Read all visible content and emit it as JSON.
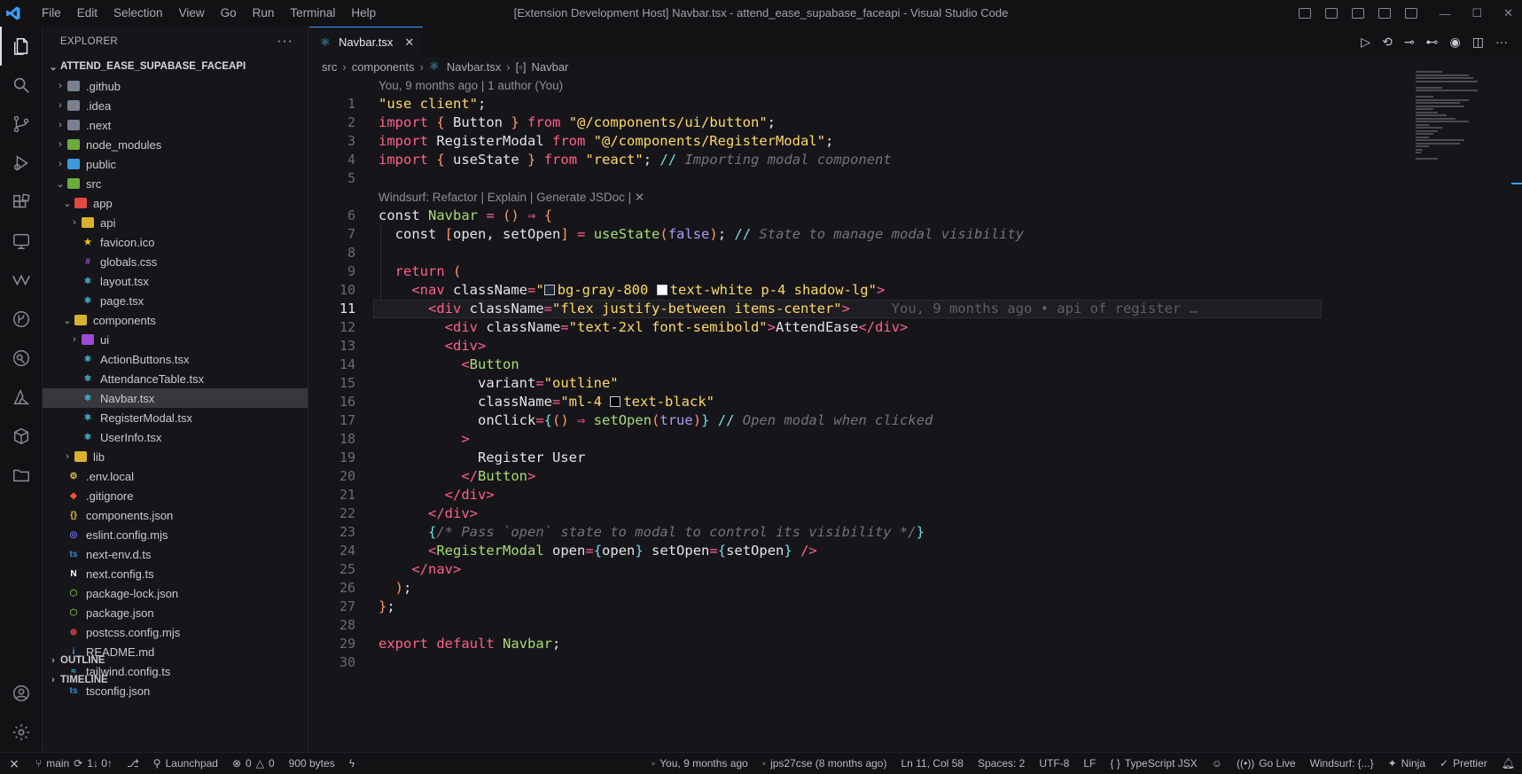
{
  "titlebar": {
    "menu": [
      "File",
      "Edit",
      "Selection",
      "View",
      "Go",
      "Run",
      "Terminal",
      "Help"
    ],
    "title": "[Extension Development Host] Navbar.tsx - attend_ease_supabase_faceapi - Visual Studio Code"
  },
  "sidebar": {
    "header": "EXPLORER",
    "project": "ATTEND_EASE_SUPABASE_FACEAPI",
    "tree": [
      {
        "label": ".github",
        "depth": 1,
        "type": "folder",
        "open": false,
        "color": "gray"
      },
      {
        "label": ".idea",
        "depth": 1,
        "type": "folder",
        "open": false,
        "color": "gray"
      },
      {
        "label": ".next",
        "depth": 1,
        "type": "folder",
        "open": false,
        "color": "gray"
      },
      {
        "label": "node_modules",
        "depth": 1,
        "type": "folder",
        "open": false,
        "color": "green"
      },
      {
        "label": "public",
        "depth": 1,
        "type": "folder",
        "open": false,
        "color": "blue"
      },
      {
        "label": "src",
        "depth": 1,
        "type": "folder",
        "open": true,
        "color": "green"
      },
      {
        "label": "app",
        "depth": 2,
        "type": "folder",
        "open": true,
        "color": "red"
      },
      {
        "label": "api",
        "depth": 3,
        "type": "folder",
        "open": false,
        "color": "yellow"
      },
      {
        "label": "favicon.ico",
        "depth": 3,
        "type": "file",
        "icon": "star"
      },
      {
        "label": "globals.css",
        "depth": 3,
        "type": "file",
        "icon": "css"
      },
      {
        "label": "layout.tsx",
        "depth": 3,
        "type": "file",
        "icon": "react"
      },
      {
        "label": "page.tsx",
        "depth": 3,
        "type": "file",
        "icon": "react"
      },
      {
        "label": "components",
        "depth": 2,
        "type": "folder",
        "open": true,
        "color": "yellow"
      },
      {
        "label": "ui",
        "depth": 3,
        "type": "folder",
        "open": false,
        "color": "purple"
      },
      {
        "label": "ActionButtons.tsx",
        "depth": 3,
        "type": "file",
        "icon": "react"
      },
      {
        "label": "AttendanceTable.tsx",
        "depth": 3,
        "type": "file",
        "icon": "react"
      },
      {
        "label": "Navbar.tsx",
        "depth": 3,
        "type": "file",
        "icon": "react",
        "selected": true
      },
      {
        "label": "RegisterModal.tsx",
        "depth": 3,
        "type": "file",
        "icon": "react"
      },
      {
        "label": "UserInfo.tsx",
        "depth": 3,
        "type": "file",
        "icon": "react"
      },
      {
        "label": "lib",
        "depth": 2,
        "type": "folder",
        "open": false,
        "color": "yellow"
      },
      {
        "label": ".env.local",
        "depth": 1,
        "type": "file",
        "icon": "env"
      },
      {
        "label": ".gitignore",
        "depth": 1,
        "type": "file",
        "icon": "git"
      },
      {
        "label": "components.json",
        "depth": 1,
        "type": "file",
        "icon": "json"
      },
      {
        "label": "eslint.config.mjs",
        "depth": 1,
        "type": "file",
        "icon": "eslint"
      },
      {
        "label": "next-env.d.ts",
        "depth": 1,
        "type": "file",
        "icon": "ts"
      },
      {
        "label": "next.config.ts",
        "depth": 1,
        "type": "file",
        "icon": "next"
      },
      {
        "label": "package-lock.json",
        "depth": 1,
        "type": "file",
        "icon": "node"
      },
      {
        "label": "package.json",
        "depth": 1,
        "type": "file",
        "icon": "node"
      },
      {
        "label": "postcss.config.mjs",
        "depth": 1,
        "type": "file",
        "icon": "postcss"
      },
      {
        "label": "README.md",
        "depth": 1,
        "type": "file",
        "icon": "info"
      },
      {
        "label": "tailwind.config.ts",
        "depth": 1,
        "type": "file",
        "icon": "tailwind"
      },
      {
        "label": "tsconfig.json",
        "depth": 1,
        "type": "file",
        "icon": "tsconfig"
      }
    ],
    "outline": "OUTLINE",
    "timeline": "TIMELINE"
  },
  "editor": {
    "tab": "Navbar.tsx",
    "breadcrumb": [
      "src",
      "components",
      "Navbar.tsx",
      "Navbar"
    ],
    "blame_header": "You, 9 months ago | 1 author (You)",
    "windsurf_lens": "Windsurf: Refactor | Explain | Generate JSDoc | ✕",
    "inline_blame": "You, 9 months ago • api of register …",
    "current_line": 11
  },
  "statusbar": {
    "branch": "main",
    "sync": "1↓ 0↑",
    "launchpad": "Launchpad",
    "problems": "0",
    "warnings": "0",
    "size": "900 bytes",
    "blame": "You, 9 months ago",
    "author": "jps27cse (8 months ago)",
    "position": "Ln 11, Col 58",
    "spaces": "Spaces: 2",
    "encoding": "UTF-8",
    "eol": "LF",
    "language": "TypeScript JSX",
    "golive": "Go Live",
    "windsurf": "Windsurf: {...}",
    "ninja": "Ninja",
    "prettier": "Prettier"
  },
  "colors": {
    "accent": "#3aa0ff",
    "background": "#16161a",
    "keyword": "#ff6188",
    "string": "#ffd866",
    "function": "#a9dc76"
  }
}
